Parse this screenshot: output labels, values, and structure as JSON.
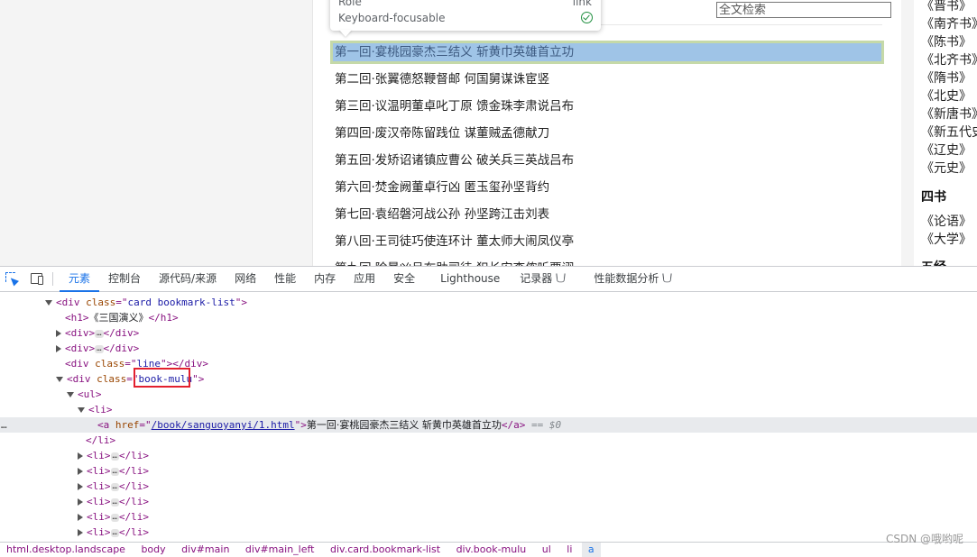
{
  "tooltip": {
    "role_label": "Role",
    "role_value": "link",
    "focus_label": "Keyboard-focusable"
  },
  "search": {
    "placeholder": "全文检索"
  },
  "chapters": [
    "第一回·宴桃园豪杰三结义 斩黄巾英雄首立功",
    "第二回·张翼德怒鞭督邮 何国舅谋诛宦竖",
    "第三回·议温明董卓叱丁原 馈金珠李肃说吕布",
    "第四回·废汉帝陈留践位 谋董贼孟德献刀",
    "第五回·发矫诏诸镇应曹公 破关兵三英战吕布",
    "第六回·焚金阙董卓行凶 匿玉玺孙坚背约",
    "第七回·袁绍磐河战公孙 孙坚跨江击刘表",
    "第八回·王司徒巧使连环计 董太师大闹凤仪亭",
    "第九回·除暴凶吕布助司徒 犯长安李傕听贾诩"
  ],
  "sidebar": {
    "history_books": [
      "《晋书》",
      "《南齐书》",
      "《陈书》",
      "《北齐书》",
      "《隋书》",
      "《北史》",
      "《新唐书》",
      "《新五代史》",
      "《辽史》",
      "《元史》"
    ],
    "heading_sishu": "四书",
    "sishu_books": [
      "《论语》",
      "《大学》"
    ],
    "heading_wujing": "五经"
  },
  "devtools": {
    "tabs": [
      "元素",
      "控制台",
      "源代码/来源",
      "网络",
      "性能",
      "内存",
      "应用",
      "安全",
      "Lighthouse",
      "记录器",
      "性能数据分析"
    ],
    "active_tab": "元素",
    "dom": {
      "l1_tag": "div",
      "l1_attr": "class",
      "l1_val": "card bookmark-list",
      "l2_tag": "h1",
      "l2_text": "《三国演义》",
      "l3_tag": "div",
      "l4_tag": "div",
      "l5_tag": "div",
      "l5_attr": "class",
      "l5_val": "line",
      "l6_tag": "div",
      "l6_attr": "class",
      "l6_val": "book-mulu",
      "l7_tag": "ul",
      "l8_tag": "li",
      "l9_tag": "a",
      "l9_attr": "href",
      "l9_val": "/book/sanguoyanyi/1.html",
      "l9_text": "第一回·宴桃园豪杰三结义 斩黄巾英雄首立功",
      "l9_eq": "== $0",
      "l10_tag": "li",
      "li_tag": "li",
      "ellipsis": "…",
      "more": "…"
    },
    "breadcrumb": [
      "html.desktop.landscape",
      "body",
      "div#main",
      "div#main_left",
      "div.card.bookmark-list",
      "div.book-mulu",
      "ul",
      "li",
      "a"
    ]
  },
  "watermark": "CSDN @哦哟呢",
  "colors": {
    "highlight_bg": "#9fc4e7",
    "highlight_border": "#c5d9a8",
    "annotation_red": "#e3202e",
    "devtools_accent": "#1a73e8"
  }
}
